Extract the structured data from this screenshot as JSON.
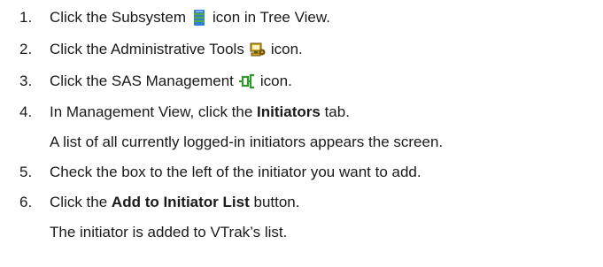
{
  "steps": [
    {
      "number": "1.",
      "before": "Click the Subsystem",
      "icon": "subsystem-icon",
      "after": "icon in Tree View."
    },
    {
      "number": "2.",
      "before": "Click the Administrative Tools",
      "icon": "administrative-tools-icon",
      "after": "icon."
    },
    {
      "number": "3.",
      "before": "Click the SAS Management",
      "icon": "sas-management-icon",
      "after": "icon."
    },
    {
      "number": "4.",
      "before": "In Management View, click the",
      "bold": "Initiators",
      "after": "tab."
    },
    {
      "note": "A list of all currently logged-in initiators appears the screen."
    },
    {
      "number": "5.",
      "text": "Check the box to the left of the initiator you want to add."
    },
    {
      "number": "6.",
      "before": "Click the",
      "bold": "Add to Initiator List",
      "after": "button."
    },
    {
      "note": "The initiator is added to VTrak’s list."
    }
  ],
  "colors": {
    "subsystem_icon": "#2f7fd6",
    "subsystem_icon_band": "#55b03a",
    "admin_tools_icon": "#c9a227",
    "admin_tools_icon_dark": "#6b5200",
    "sas_icon": "#2f9a2a"
  }
}
